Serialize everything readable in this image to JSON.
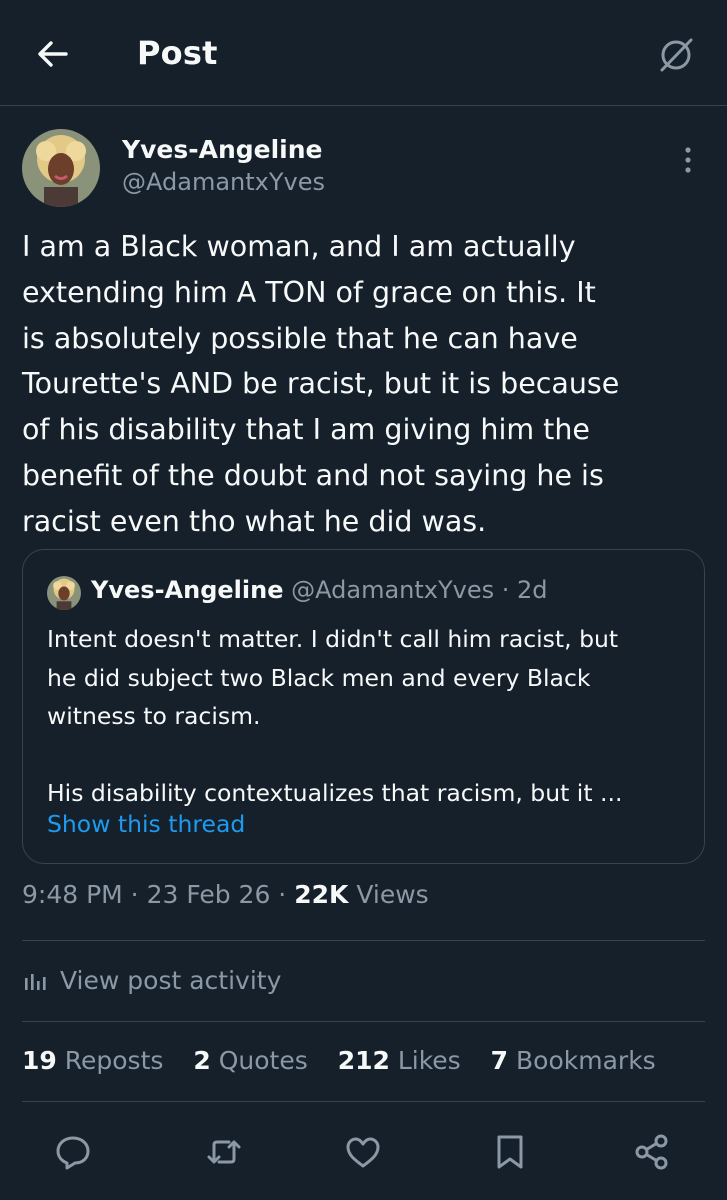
{
  "header": {
    "title": "Post"
  },
  "author": {
    "name": "Yves-Angeline",
    "handle": "@AdamantxYves"
  },
  "post": {
    "lines": [
      "I am a Black woman, and I am actually",
      "extending him A TON of grace on this. It",
      "is absolutely possible that he can have",
      "Tourette's AND be racist, but it is because",
      "of his disability that I am giving him the",
      "benefit of the doubt and not saying he is",
      "racist even tho what he did was."
    ]
  },
  "quote": {
    "name": "Yves-Angeline",
    "meta": "@AdamantxYves · 2d",
    "lines": [
      "Intent doesn't matter. I didn't call him racist, but",
      "he did subject two Black men and every Black",
      "witness to racism.",
      "",
      "His disability contextualizes that racism, but it ..."
    ],
    "show_thread": "Show this thread"
  },
  "timestamp": {
    "time_date": "9:48 PM · 23 Feb 26 · ",
    "views_count": "22K",
    "views_label": " Views"
  },
  "activity": {
    "label": "View post activity"
  },
  "stats": [
    {
      "count": "19",
      "label": "Reposts"
    },
    {
      "count": "2",
      "label": "Quotes"
    },
    {
      "count": "212",
      "label": "Likes"
    },
    {
      "count": "7",
      "label": "Bookmarks"
    }
  ],
  "actions": [
    "reply-icon",
    "repost-icon",
    "like-icon",
    "bookmark-icon",
    "share-icon"
  ],
  "colors": {
    "background": "#15202b",
    "text": "#f7f9f9",
    "muted": "#8b98a5",
    "accent": "#1d9bf0",
    "border": "#38444d"
  }
}
